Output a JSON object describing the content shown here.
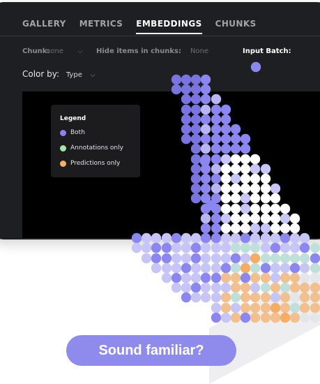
{
  "tabs": [
    {
      "label": "GALLERY",
      "active": false
    },
    {
      "label": "METRICS",
      "active": false
    },
    {
      "label": "EMBEDDINGS",
      "active": true
    },
    {
      "label": "CHUNKS",
      "active": false
    }
  ],
  "filters": {
    "chunk_label": "Chunk:",
    "chunk_value": "none",
    "hide_label": "Hide items in chunks:",
    "hide_value": "None",
    "input_batch_label": "Input Batch:"
  },
  "color_by": {
    "label": "Color by:",
    "value": "Type"
  },
  "legend": {
    "title": "Legend",
    "items": [
      {
        "label": "Both",
        "color": "#8a82ee"
      },
      {
        "label": "Annotations only",
        "color": "#a8e6a8"
      },
      {
        "label": "Predictions only",
        "color": "#f5b06a"
      }
    ]
  },
  "cta": {
    "label": "Sound familiar?"
  },
  "colors": {
    "window_bg": "#1e1f22",
    "plot_bg": "#000000",
    "accent": "#8f8bec",
    "both": "#8a82ee",
    "annotations": "#a8e6a8",
    "predictions": "#f5b06a"
  },
  "chart_data": {
    "type": "scatter",
    "series_colors": {
      "both": "#8a82ee",
      "annotations_only": "#a8e6a8",
      "predictions_only": "#f5b06a"
    }
  }
}
